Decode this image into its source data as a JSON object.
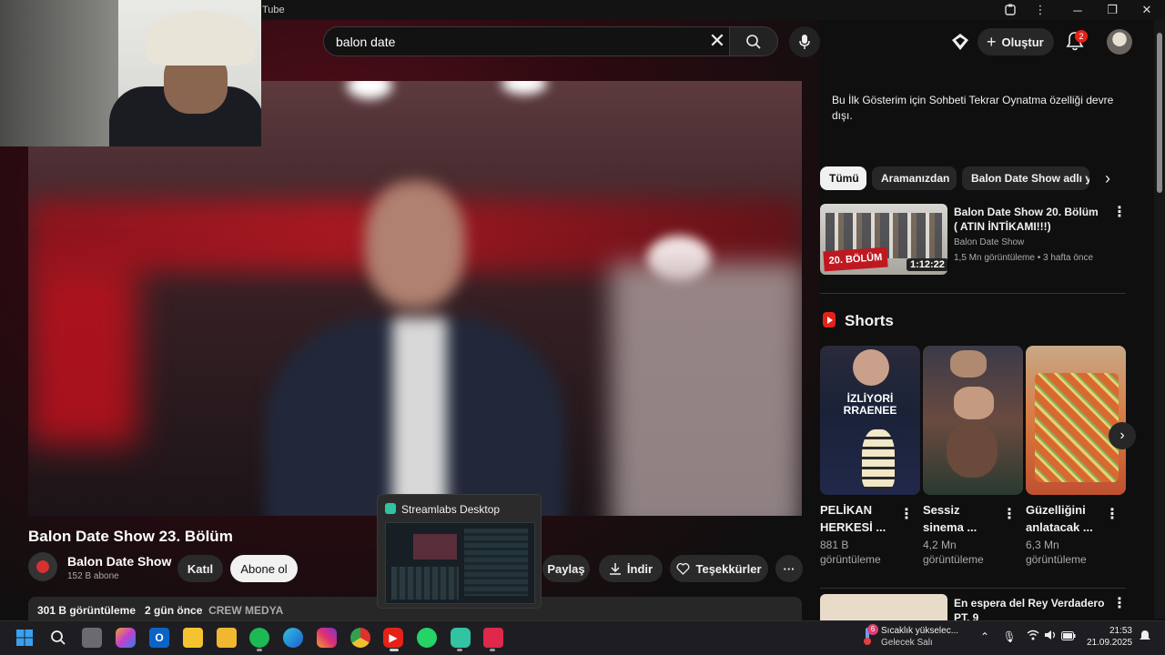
{
  "window": {
    "title": "Tube"
  },
  "search": {
    "value": "balon date"
  },
  "header": {
    "create_label": "Oluştur",
    "notifications_count": "2"
  },
  "video": {
    "title": "Balon Date Show 23. Bölüm",
    "channel_name": "Balon Date Show",
    "subscribers": "152 B abone",
    "join_label": "Katıl",
    "subscribe_label": "Abone ol",
    "share_label": "Paylaş",
    "download_label": "İndir",
    "thanks_label": "Teşekkürler",
    "views": "301 B görüntüleme",
    "age": "2 gün önce",
    "tag": "CREW MEDYA"
  },
  "taskbar_preview": {
    "title": "Streamlabs Desktop"
  },
  "sidebar": {
    "chat_notice": "Bu İlk Gösterim için Sohbeti Tekrar Oynatma özelliği devre dışı.",
    "chips": [
      "Tümü",
      "Aramanızdan",
      "Balon Date Show adlı yü"
    ],
    "recommended": {
      "thumb_label": "20. BÖLÜM",
      "duration": "1:12:22",
      "title": "Balon Date Show 20. Bölüm ( ATIN İNTİKAMI!!!)",
      "channel": "Balon Date Show",
      "meta": "1,5 Mn görüntüleme • 3 hafta önce"
    },
    "shorts_title": "Shorts",
    "shorts": [
      {
        "title": "PELİKAN HERKESİ ...",
        "views": "881 B görüntüleme",
        "thumb_text": "İZLİYORİ RRAENEE"
      },
      {
        "title": "Sessiz sinema ...",
        "views": "4,2 Mn görüntüleme"
      },
      {
        "title": "Güzelliğini anlatacak ...",
        "views": "6,3 Mn görüntüleme"
      }
    ],
    "next_video": {
      "title": "En espera del Rey Verdadero PT. 9"
    }
  },
  "system": {
    "weather_title": "Sıcaklık yükselec...",
    "weather_sub": "Gelecek Salı",
    "weather_badge": "6",
    "time": "21:53",
    "date": "21.09.2025"
  },
  "colors": {
    "accent_red": "#e62117",
    "background": "#0f0f0f",
    "chip_active": "#f1f1f1"
  }
}
